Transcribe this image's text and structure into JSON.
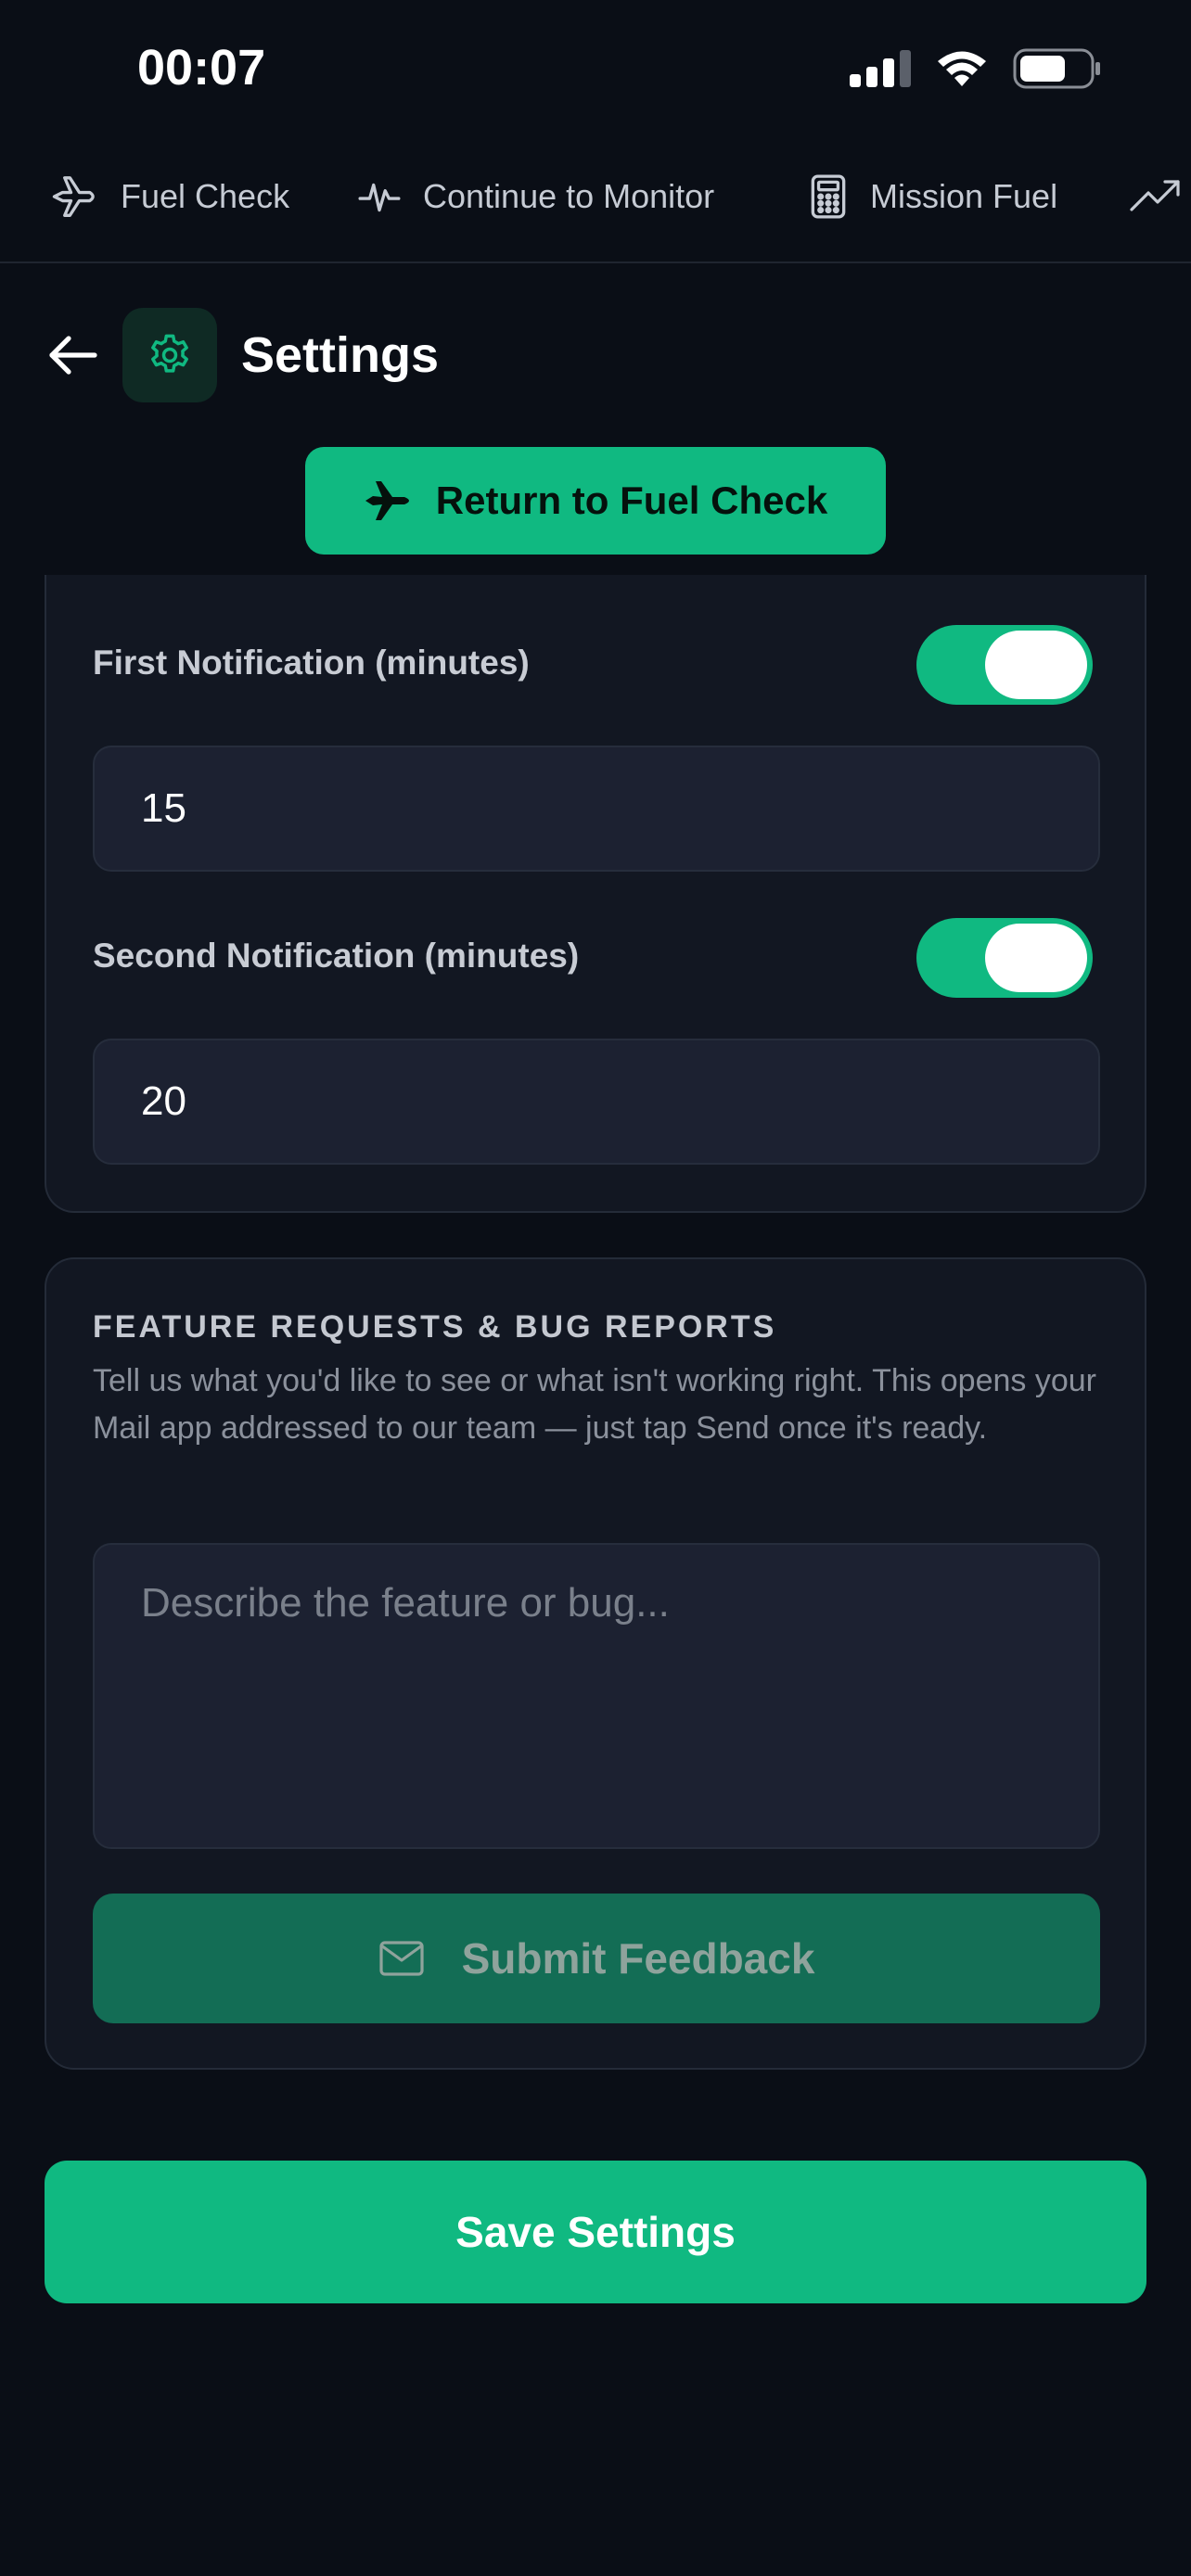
{
  "status_bar": {
    "time": "00:07"
  },
  "nav": {
    "items": [
      {
        "label": "Fuel Check",
        "icon": "plane-icon"
      },
      {
        "label": "Continue to Monitor",
        "icon": "activity-icon"
      },
      {
        "label": "Mission Fuel",
        "icon": "calculator-icon"
      },
      {
        "label": "",
        "icon": "trending-up-icon"
      }
    ]
  },
  "header": {
    "title": "Settings",
    "icon": "gear-icon"
  },
  "return_button": {
    "label": "Return to Fuel Check",
    "icon": "plane-icon"
  },
  "notifications": {
    "first": {
      "label": "First Notification (minutes)",
      "enabled": true,
      "value": "15"
    },
    "second": {
      "label": "Second Notification (minutes)",
      "enabled": true,
      "value": "20"
    }
  },
  "feedback": {
    "heading": "FEATURE REQUESTS & BUG REPORTS",
    "description": "Tell us what you'd like to see or what isn't working right. This opens your Mail app addressed to our team — just tap Send once it's ready.",
    "placeholder": "Describe the feature or bug...",
    "submit_label": "Submit Feedback",
    "submit_icon": "mail-icon"
  },
  "save_button": {
    "label": "Save Settings"
  },
  "colors": {
    "accent": "#10b981",
    "background": "#0a0e16",
    "card": "#121722",
    "input": "#1c2131",
    "submit_disabled": "#136d55"
  }
}
